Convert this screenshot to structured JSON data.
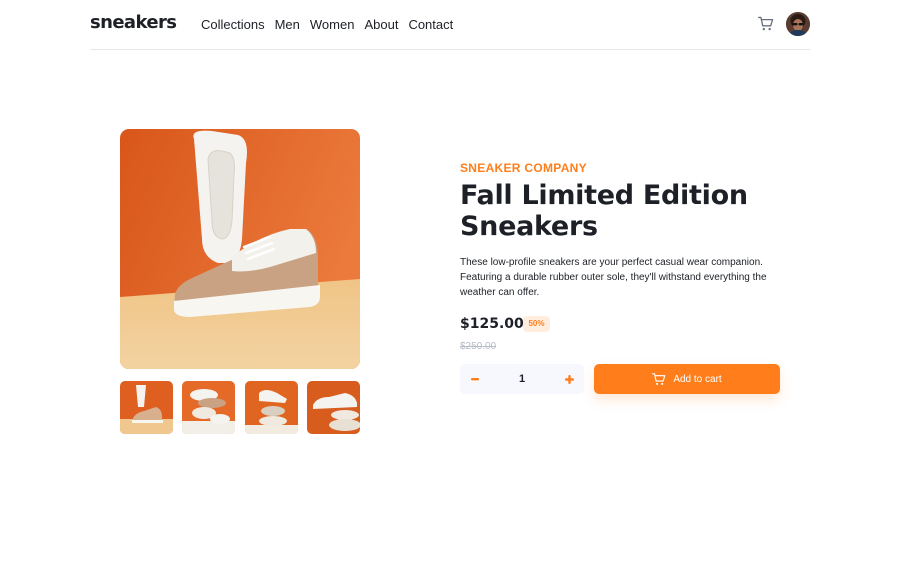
{
  "header": {
    "logo": "sneakers",
    "nav": [
      "Collections",
      "Men",
      "Women",
      "About",
      "Contact"
    ],
    "cart_icon": "cart-icon",
    "avatar_icon": "avatar"
  },
  "product": {
    "company": "SNEAKER COMPANY",
    "title": "Fall Limited Edition Sneakers",
    "description": "These low-profile sneakers are your perfect casual wear companion. Featuring a durable rubber outer sole, they'll withstand everything the weather can offer.",
    "price": "$125.00",
    "discount": "50%",
    "original_price": "$250.00",
    "quantity": "1",
    "add_to_cart": "Add to cart"
  },
  "gallery": {
    "thumbnail_count": 4
  },
  "colors": {
    "accent": "#ff7e1b",
    "accent_pale": "#ffede0",
    "text_dark": "#1d2026",
    "text_muted": "#b6bcc8",
    "qty_bg": "#f6f8fd",
    "photo_orange": "#e0661e",
    "photo_sand": "#efc98d"
  }
}
